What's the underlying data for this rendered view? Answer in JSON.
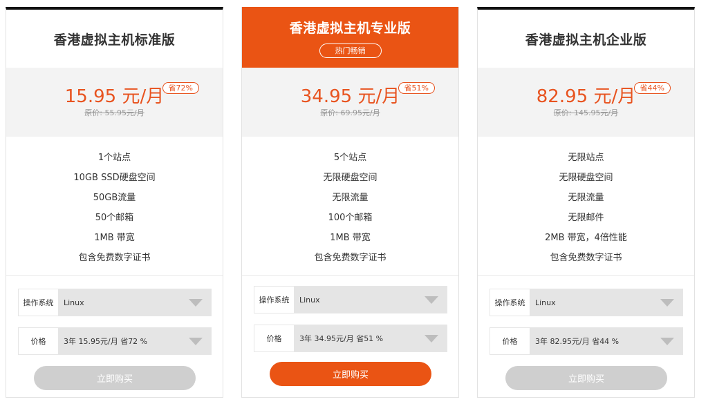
{
  "colors": {
    "accent": "#ea5414",
    "price": "#e8531f",
    "disabled_button": "#cfcfcf"
  },
  "icons": {
    "dropdown": "caret-down-icon"
  },
  "plans": [
    {
      "title": "香港虚拟主机标准版",
      "badge": "",
      "price": "15.95 元/月",
      "original_price": "原价: 55.95元/月",
      "save": "省72%",
      "features": [
        "1个站点",
        "10GB SSD硬盘空间",
        "50GB流量",
        "50个邮箱",
        "1MB 带宽",
        "包含免费数字证书"
      ],
      "os_label": "操作系统",
      "os_value": "Linux",
      "price_label": "价格",
      "price_value": "3年 15.95元/月 省72 %",
      "buy_label": "立即购买"
    },
    {
      "title": "香港虚拟主机专业版",
      "badge": "热门畅销",
      "price": "34.95 元/月",
      "original_price": "原价: 69.95元/月",
      "save": "省51%",
      "features": [
        "5个站点",
        "无限硬盘空间",
        "无限流量",
        "100个邮箱",
        "1MB 带宽",
        "包含免费数字证书"
      ],
      "os_label": "操作系统",
      "os_value": "Linux",
      "price_label": "价格",
      "price_value": "3年 34.95元/月 省51 %",
      "buy_label": "立即购买"
    },
    {
      "title": "香港虚拟主机企业版",
      "badge": "",
      "price": "82.95 元/月",
      "original_price": "原价: 145.95元/月",
      "save": "省44%",
      "features": [
        "无限站点",
        "无限硬盘空间",
        "无限流量",
        "无限邮件",
        "2MB 带宽，4倍性能",
        "包含免费数字证书"
      ],
      "os_label": "操作系统",
      "os_value": "Linux",
      "price_label": "价格",
      "price_value": "3年 82.95元/月 省44 %",
      "buy_label": "立即购买"
    }
  ]
}
